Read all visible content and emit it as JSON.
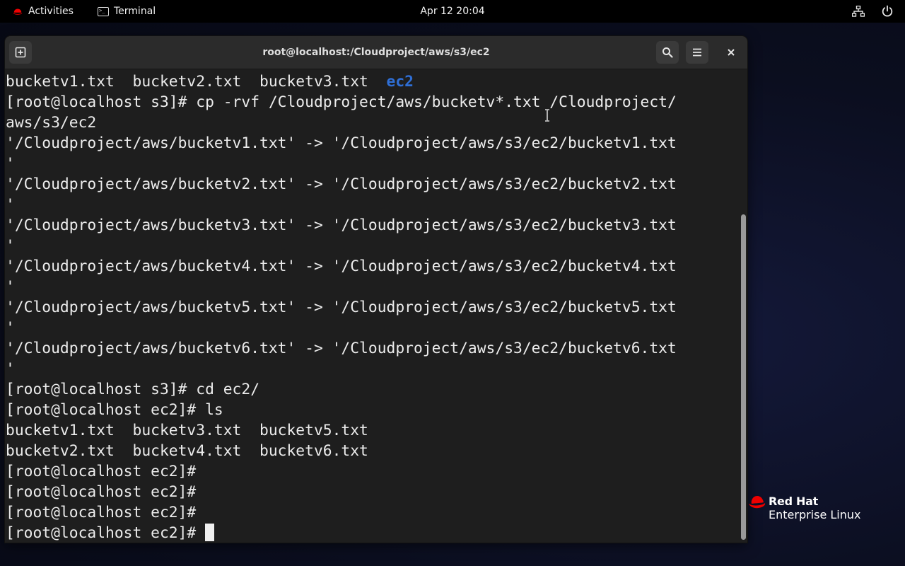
{
  "topbar": {
    "activities_label": "Activities",
    "app_label": "Terminal",
    "clock": "Apr 12  20:04",
    "icons": [
      "redhat-icon",
      "terminal-icon",
      "network-icon",
      "power-icon"
    ]
  },
  "window": {
    "title": "root@localhost:/Cloudproject/aws/s3/ec2",
    "buttons": [
      "new-tab",
      "search",
      "menu",
      "close"
    ],
    "close_glyph": "×"
  },
  "terminal": {
    "lines": [
      {
        "text": "bucketv1.txt  bucketv2.txt  bucketv3.txt  ",
        "dir": "ec2"
      },
      {
        "text": "[root@localhost s3]# cp -rvf /Cloudproject/aws/bucketv*.txt /Cloudproject/"
      },
      {
        "text": "aws/s3/ec2"
      },
      {
        "text": "'/Cloudproject/aws/bucketv1.txt' -> '/Cloudproject/aws/s3/ec2/bucketv1.txt"
      },
      {
        "text": "'"
      },
      {
        "text": "'/Cloudproject/aws/bucketv2.txt' -> '/Cloudproject/aws/s3/ec2/bucketv2.txt"
      },
      {
        "text": "'"
      },
      {
        "text": "'/Cloudproject/aws/bucketv3.txt' -> '/Cloudproject/aws/s3/ec2/bucketv3.txt"
      },
      {
        "text": "'"
      },
      {
        "text": "'/Cloudproject/aws/bucketv4.txt' -> '/Cloudproject/aws/s3/ec2/bucketv4.txt"
      },
      {
        "text": "'"
      },
      {
        "text": "'/Cloudproject/aws/bucketv5.txt' -> '/Cloudproject/aws/s3/ec2/bucketv5.txt"
      },
      {
        "text": "'"
      },
      {
        "text": "'/Cloudproject/aws/bucketv6.txt' -> '/Cloudproject/aws/s3/ec2/bucketv6.txt"
      },
      {
        "text": "'"
      },
      {
        "text": "[root@localhost s3]# cd ec2/"
      },
      {
        "text": "[root@localhost ec2]# ls"
      },
      {
        "text": "bucketv1.txt  bucketv3.txt  bucketv5.txt"
      },
      {
        "text": "bucketv2.txt  bucketv4.txt  bucketv6.txt"
      },
      {
        "text": "[root@localhost ec2]#"
      },
      {
        "text": "[root@localhost ec2]#"
      },
      {
        "text": "[root@localhost ec2]#"
      },
      {
        "text": "[root@localhost ec2]# ",
        "cursor": true
      }
    ],
    "colors": {
      "background": "#1e1e1e",
      "foreground": "#ececec",
      "directory": "#2f6fd6"
    }
  },
  "branding": {
    "line1": "Red Hat",
    "line2": "Enterprise Linux",
    "accent": "#ee0000"
  }
}
